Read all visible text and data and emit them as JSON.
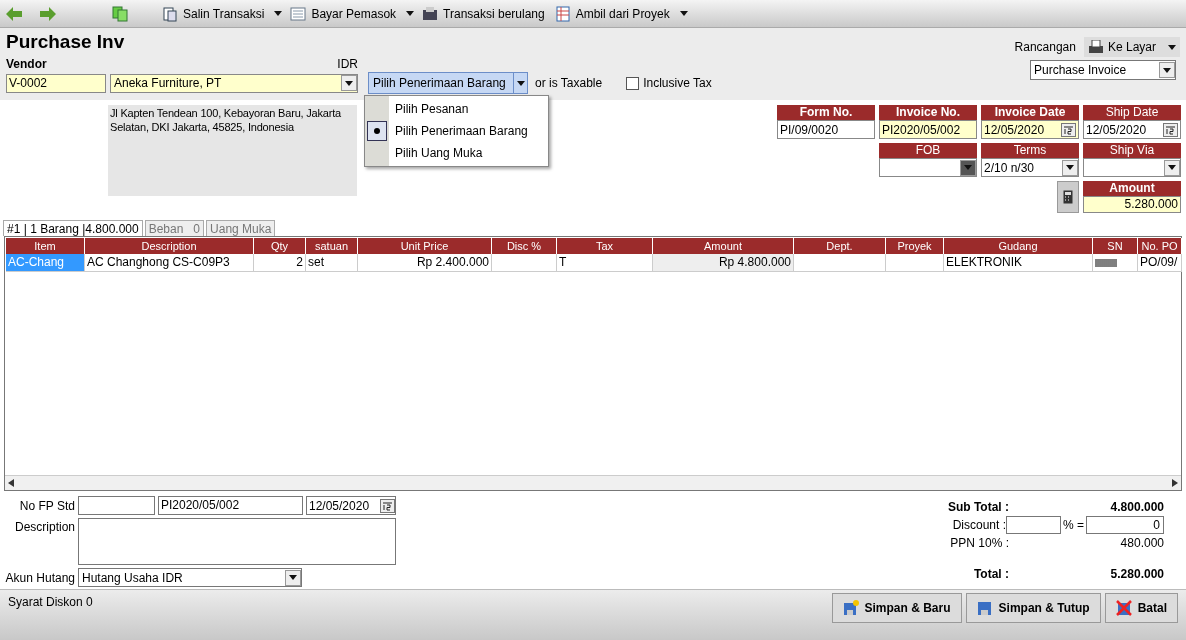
{
  "toolbar": [
    {
      "kind": "back"
    },
    {
      "kind": "forward"
    },
    {
      "kind": "copy"
    },
    {
      "kind": "copy-transaction",
      "label": "Salin Transaksi",
      "dropdown": true
    },
    {
      "kind": "pay-vendor",
      "label": "Bayar Pemasok",
      "dropdown": true
    },
    {
      "kind": "recurring",
      "label": "Transaksi berulang",
      "dropdown": false
    },
    {
      "kind": "from-project",
      "label": "Ambil dari Proyek",
      "dropdown": true
    }
  ],
  "title": "Purchase Inv",
  "vendor": {
    "label": "Vendor",
    "currency": "IDR",
    "code": "V-0002",
    "name": "Aneka Furniture, PT",
    "address": "Jl Kapten Tendean 100, Kebayoran Baru, Jakarta Selatan, DKI Jakarta, 45825, Indonesia"
  },
  "pick_button": {
    "label": "Pilih Penerimaan Barang"
  },
  "pick_menu": [
    {
      "label": "Pilih Pesanan",
      "selected": false
    },
    {
      "label": "Pilih Penerimaan Barang",
      "selected": true
    },
    {
      "label": "Pilih Uang Muka",
      "selected": false
    }
  ],
  "taxable": {
    "label": "or is Taxable"
  },
  "inclusive_tax": {
    "label": "Inclusive Tax",
    "checked": false
  },
  "print": {
    "label": "Rancangan",
    "button": "Ke Layar",
    "template": "Purchase Invoice"
  },
  "header_fields": [
    {
      "label": "Form No.",
      "value": "PI/09/0020",
      "kind": "text",
      "bold": true,
      "required": false
    },
    {
      "label": "Invoice No.",
      "value": "PI2020/05/002",
      "kind": "text",
      "bold": true,
      "required": true
    },
    {
      "label": "Invoice Date",
      "value": "12/05/2020",
      "kind": "date",
      "bold": true,
      "required": true
    },
    {
      "label": "Ship Date",
      "value": "12/05/2020",
      "kind": "date",
      "bold": false,
      "required": false
    }
  ],
  "header_fields_2": [
    {
      "label": "FOB",
      "kind": "dark-select"
    },
    {
      "label": "Terms",
      "value": "2/10 n/30",
      "kind": "select"
    },
    {
      "label": "Ship Via",
      "kind": "select"
    }
  ],
  "amount": {
    "label": "Amount",
    "value": "5.280.000"
  },
  "tabs": [
    {
      "label": "#1 | 1 Barang |4.800.000",
      "selected": true
    },
    {
      "label": "Beban   0",
      "selected": false
    },
    {
      "label": "Uang Muka",
      "selected": false
    }
  ],
  "table": {
    "columns": [
      "Item",
      "Description",
      "Qty",
      "satuan",
      "Unit Price",
      "Disc %",
      "Tax",
      "Amount",
      "Dept.",
      "Proyek",
      "Gudang",
      "SN",
      "No. PO"
    ],
    "rows": [
      {
        "cells": [
          "AC-Chang",
          "AC Changhong CS-C09P3",
          "2",
          "set",
          "Rp 2.400.000",
          "",
          "T",
          "Rp 4.800.000",
          "",
          "",
          "ELEKTRONIK",
          "",
          "PO/09/"
        ],
        "selected": true
      }
    ]
  },
  "footer_left": {
    "fp_label": "No FP Std",
    "fp_number": "PI2020/05/002",
    "fp_date": "12/05/2020",
    "description_label": "Description",
    "account_label": "Akun Hutang",
    "account": "Hutang Usaha IDR"
  },
  "totals": {
    "subtotal_label": "Sub Total :",
    "subtotal": "4.800.000",
    "discount_label": "Discount :",
    "percent_sign": "% =",
    "discount_value": "0",
    "tax_label": "PPN 10% :",
    "tax": "480.000",
    "total_label": "Total :",
    "total": "5.280.000"
  },
  "status": "Syarat Diskon 0",
  "buttons": [
    {
      "label": "Simpan & Baru",
      "kind": "save-new"
    },
    {
      "label": "Simpan & Tutup",
      "kind": "save"
    },
    {
      "label": "Batal",
      "kind": "cancel"
    }
  ]
}
